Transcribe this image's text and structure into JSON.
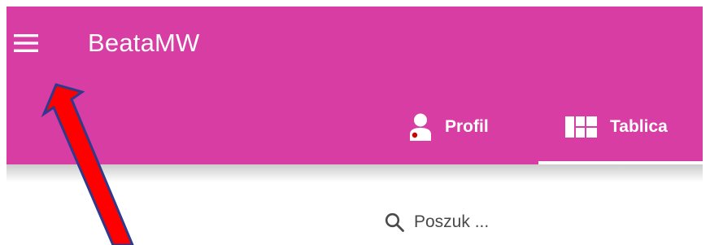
{
  "appbar": {
    "title": "BeataMW",
    "background_color": "#d83da4",
    "menu_icon": "hamburger-menu-icon"
  },
  "tabs": [
    {
      "label": "Profil",
      "icon": "person-icon",
      "selected": false
    },
    {
      "label": "Tablica",
      "icon": "dashboard-icon",
      "selected": true
    }
  ],
  "search": {
    "placeholder": "Poszuk ...",
    "icon": "search-icon"
  },
  "annotation": {
    "type": "arrow",
    "fill_color": "#ff0000",
    "outline_color": "#2e3a8c",
    "points_to": "hamburger-menu-icon"
  }
}
